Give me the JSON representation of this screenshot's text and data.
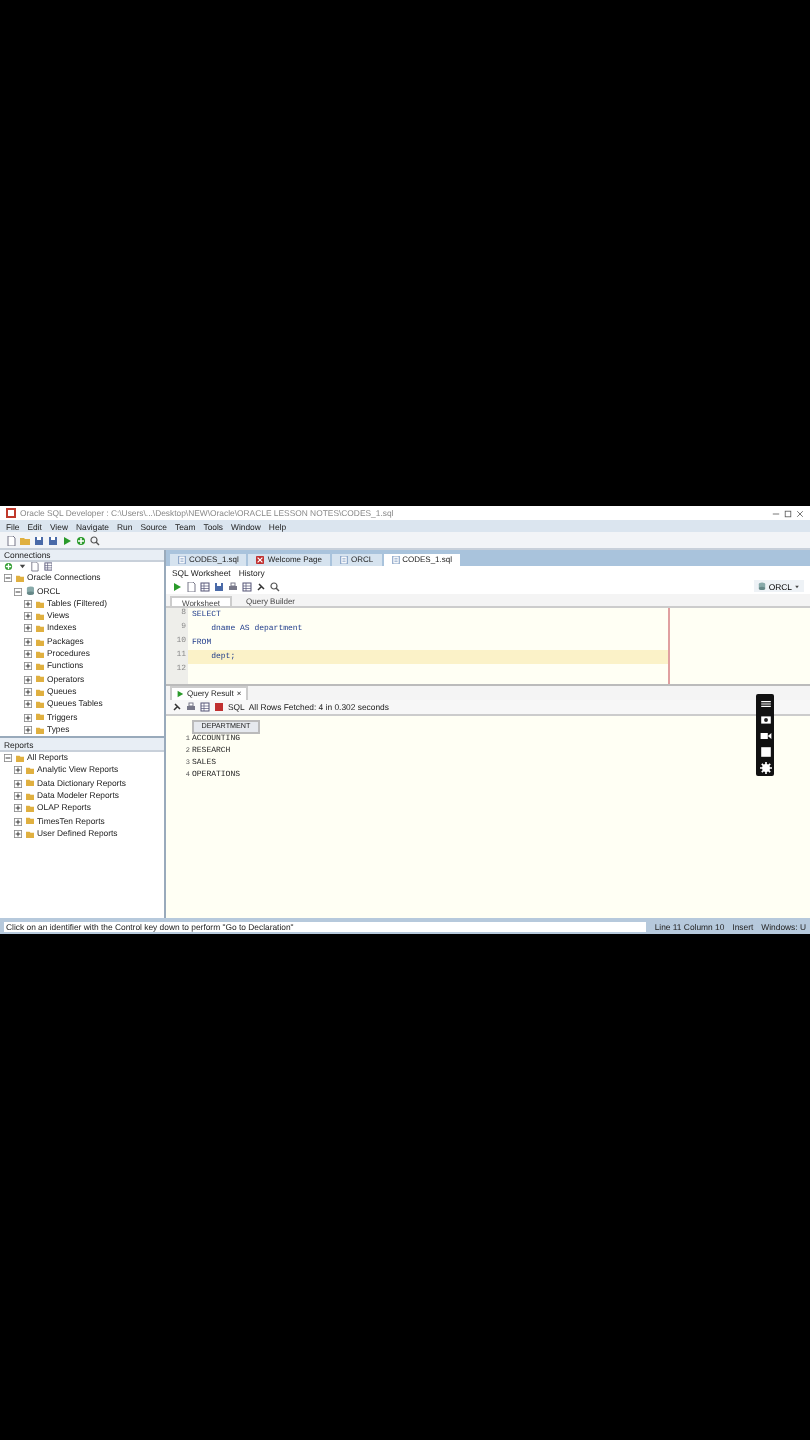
{
  "window": {
    "title": "Oracle SQL Developer : C:\\Users\\...\\Desktop\\NEW\\Oracle\\ORACLE LESSON NOTES\\CODES_1.sql"
  },
  "menu": [
    "File",
    "Edit",
    "View",
    "Navigate",
    "Run",
    "Source",
    "Team",
    "Tools",
    "Window",
    "Help"
  ],
  "connections": {
    "title": "Connections",
    "tree": [
      {
        "label": "Oracle Connections",
        "expanded": true,
        "children": [
          {
            "label": "ORCL",
            "expanded": true,
            "children": [
              {
                "label": "Tables (Filtered)",
                "expanded": false
              },
              {
                "label": "Views",
                "expanded": false
              },
              {
                "label": "Indexes",
                "expanded": false
              },
              {
                "label": "Packages",
                "expanded": false
              },
              {
                "label": "Procedures",
                "expanded": false
              },
              {
                "label": "Functions",
                "expanded": false
              },
              {
                "label": "Operators",
                "expanded": false
              },
              {
                "label": "Queues",
                "expanded": false
              },
              {
                "label": "Queues Tables",
                "expanded": false
              },
              {
                "label": "Triggers",
                "expanded": false
              },
              {
                "label": "Types",
                "expanded": false
              }
            ]
          }
        ]
      }
    ]
  },
  "reports": {
    "title": "Reports",
    "tree": [
      {
        "label": "All Reports",
        "expanded": true,
        "children": [
          {
            "label": "Analytic View Reports",
            "expanded": false
          },
          {
            "label": "Data Dictionary Reports",
            "expanded": false
          },
          {
            "label": "Data Modeler Reports",
            "expanded": false
          },
          {
            "label": "OLAP Reports",
            "expanded": false
          },
          {
            "label": "TimesTen Reports",
            "expanded": false
          },
          {
            "label": "User Defined Reports",
            "expanded": false
          }
        ]
      }
    ]
  },
  "document_tabs": [
    {
      "label": "CODES_1.sql",
      "selected": false
    },
    {
      "label": "Welcome Page",
      "selected": false
    },
    {
      "label": "ORCL",
      "selected": false
    },
    {
      "label": "CODES_1.sql",
      "selected": true
    }
  ],
  "worksheet": {
    "title": "SQL Worksheet",
    "history": "History",
    "connection": "ORCL",
    "tabs": [
      {
        "label": "Worksheet",
        "selected": true
      },
      {
        "label": "Query Builder",
        "selected": false
      }
    ],
    "lines": [
      {
        "number": "8",
        "text": "SELECT",
        "current": false
      },
      {
        "number": "9",
        "text": "    dname AS department",
        "current": false
      },
      {
        "number": "10",
        "text": "FROM",
        "current": false
      },
      {
        "number": "11",
        "text": "    dept;",
        "current": true
      },
      {
        "number": "12",
        "current": false
      }
    ]
  },
  "query_result": {
    "tab": "Query Result",
    "close": "×",
    "sql": "SQL",
    "message": "All Rows Fetched: 4 in 0.302 seconds",
    "columns": [
      "DEPARTMENT"
    ],
    "rows": [
      {
        "number": "1",
        "cells": [
          "ACCOUNTING"
        ]
      },
      {
        "number": "2",
        "cells": [
          "RESEARCH"
        ]
      },
      {
        "number": "3",
        "cells": [
          "SALES"
        ]
      },
      {
        "number": "4",
        "cells": [
          "OPERATIONS"
        ]
      }
    ]
  },
  "status_bar": {
    "message": "Click on an identifier with the Control key down to perform \"Go to Declaration\"",
    "position": "Line 11 Column 10",
    "mode": "Insert",
    "line_ending": "Windows: U"
  }
}
